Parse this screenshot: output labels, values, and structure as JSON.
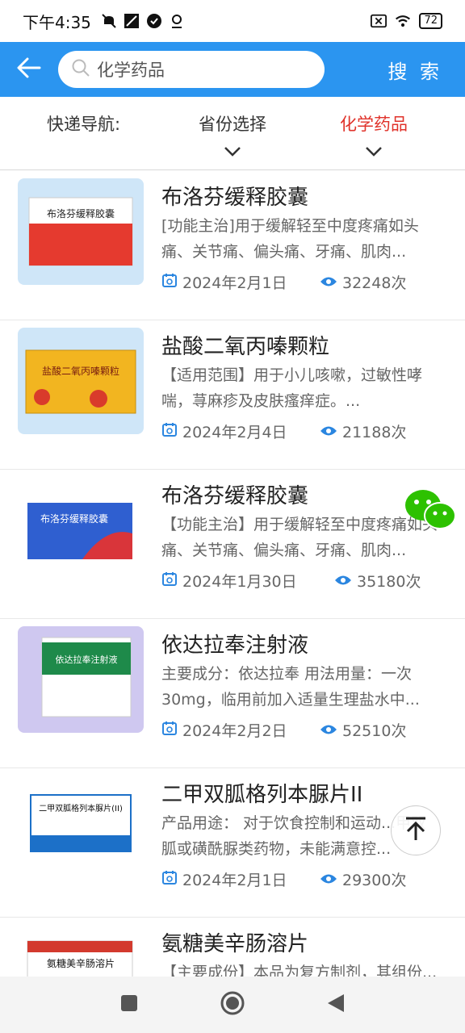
{
  "status_bar": {
    "time": "下午4:35",
    "battery": "72"
  },
  "header": {
    "search_value": "化学药品",
    "search_button": "搜 索"
  },
  "filters": {
    "label": "快递导航:",
    "province": "省份选择",
    "category": "化学药品"
  },
  "items": [
    {
      "title": "布洛芬缓释胶囊",
      "desc": "[功能主治]用于缓解轻至中度疼痛如头痛、关节痛、偏头痛、牙痛、肌肉...",
      "date": "2024年2月1日",
      "views": "32248次",
      "box_color": "#e53a2f",
      "box_label": "布洛芬缓释胶囊"
    },
    {
      "title": "盐酸二氧丙嗪颗粒",
      "desc": "【适用范围】用于小儿咳嗽，过敏性哮喘，荨麻疹及皮肤瘙痒症。...",
      "date": "2024年2月4日",
      "views": "21188次",
      "box_color": "#f2b520",
      "box_label": "盐酸二氧丙嗪颗粒"
    },
    {
      "title": "布洛芬缓释胶囊",
      "desc": "【功能主治】用于缓解轻至中度疼痛如头痛、关节痛、偏头痛、牙痛、肌肉...",
      "date": "2024年1月30日",
      "views": "35180次",
      "box_color": "#2f5fd0",
      "box_label": "布洛芬缓释胶囊"
    },
    {
      "title": "依达拉奉注射液",
      "desc": "主要成分：依达拉奉 用法用量：一次30mg，临用前加入适量生理盐水中...",
      "date": "2024年2月2日",
      "views": "52510次",
      "box_color": "#1e8a4a",
      "box_label": "依达拉奉注射液"
    },
    {
      "title": "二甲双胍格列本脲片II",
      "desc": "产品用途： 对于饮食控制和运动...甲双胍或磺酰脲类药物，未能满意控...",
      "date": "2024年2月1日",
      "views": "29300次",
      "box_color": "#1c70c8",
      "box_label": "二甲双胍格列本脲片(II)"
    },
    {
      "title": "氨糖美辛肠溶片",
      "desc": "【主要成份】本品为复方制剂，其组份...",
      "date": "",
      "views": "",
      "box_color": "#d33a2e",
      "box_label": "氨糖美辛肠溶片"
    }
  ],
  "icons": {
    "back": "arrow-left-icon",
    "search": "search-icon",
    "calendar": "calendar-icon",
    "eye": "eye-icon",
    "wechat": "wechat-icon",
    "to_top": "arrow-up-icon"
  },
  "colors": {
    "header": "#2b95f0",
    "active_filter": "#e0322a",
    "meta_icon": "#2b86e0"
  }
}
